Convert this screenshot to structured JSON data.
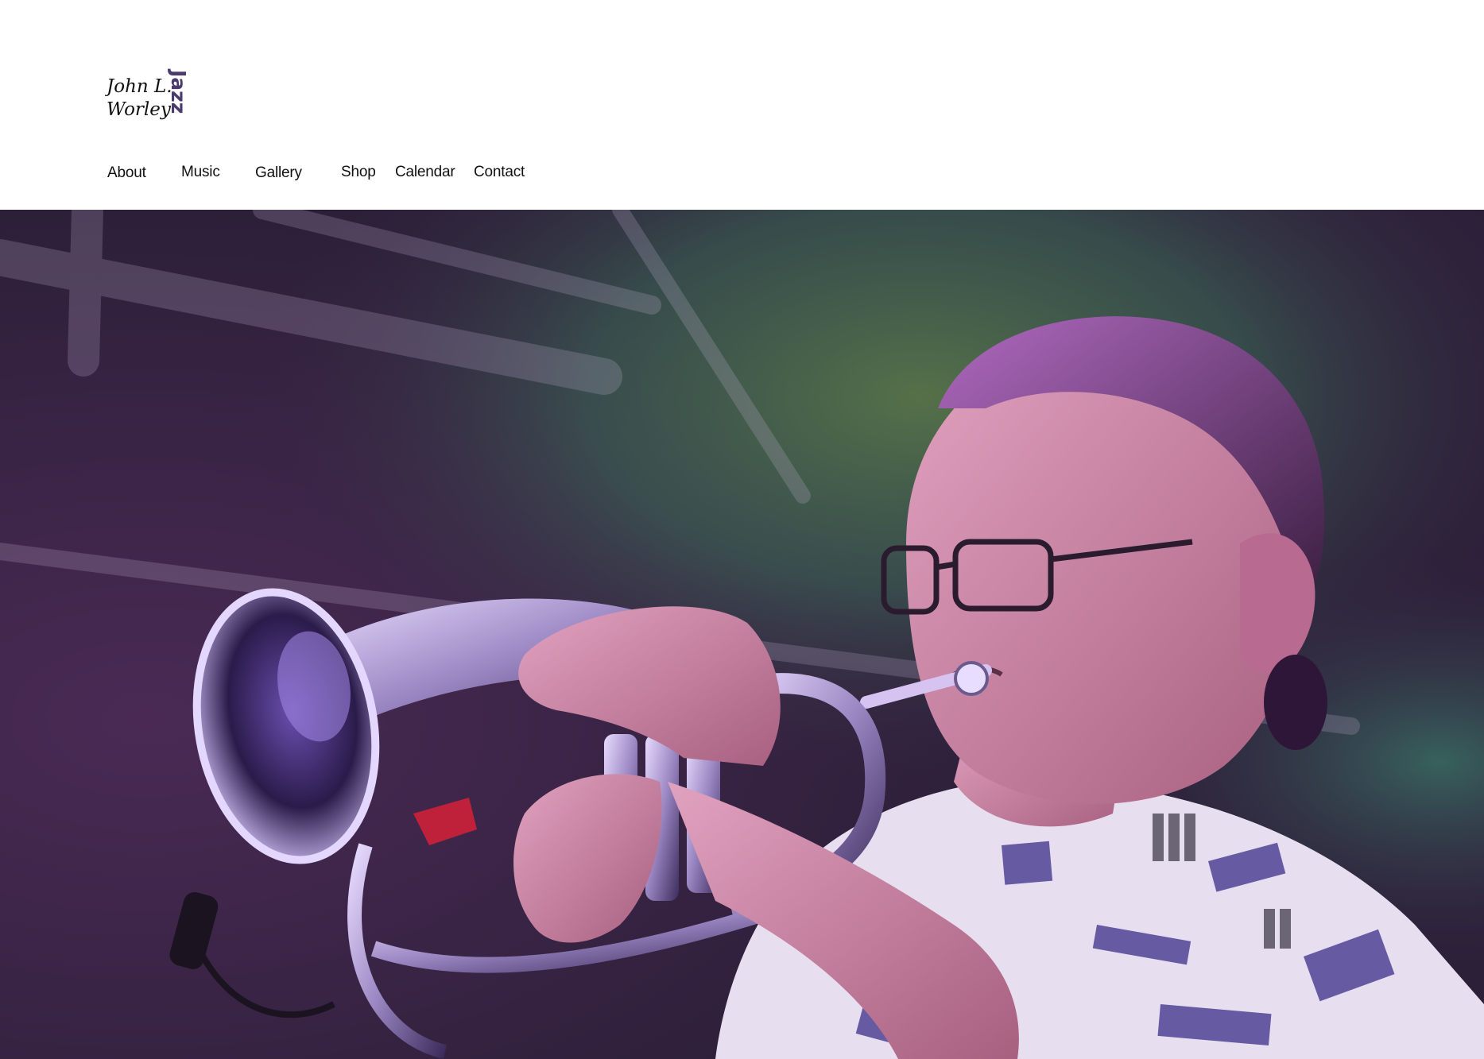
{
  "site": {
    "logo_line1": "John L.",
    "logo_line2": "Worley",
    "logo_mark": "Jazz",
    "logo_accent_color": "#4b3a6e"
  },
  "nav": {
    "items": [
      {
        "label": "About"
      },
      {
        "label": "Music"
      },
      {
        "label": "Gallery"
      },
      {
        "label": "Shop"
      },
      {
        "label": "Calendar"
      },
      {
        "label": "Contact"
      }
    ]
  },
  "hero": {
    "image_icon": "performer-photo",
    "palette": {
      "background": "#3a2748",
      "stage_green": "#3f6f5a",
      "stage_magenta": "#6a2f7e",
      "horn_silver": "#c9b8e6",
      "skin": "#c77f9e",
      "shirt": "#e7dff0"
    }
  }
}
